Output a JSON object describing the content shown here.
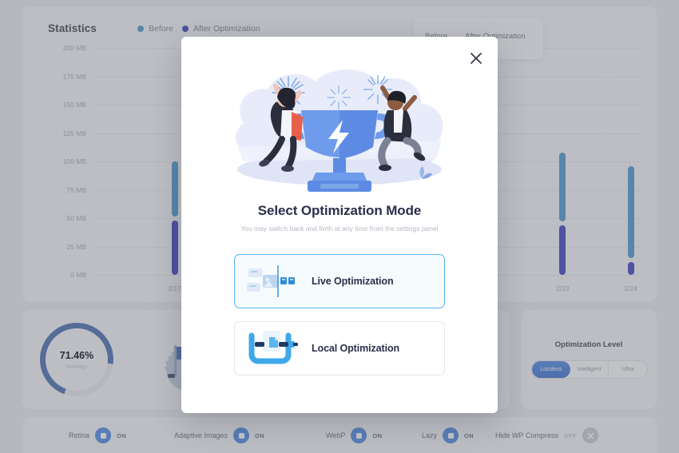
{
  "statistics": {
    "title": "Statistics",
    "legend": [
      {
        "label": "Before",
        "color": "#3d8fc6",
        "icon": "legend-dot-icon"
      },
      {
        "label": "After Optimization",
        "color": "#2e2fb8",
        "icon": "legend-dot-icon"
      }
    ],
    "tooltip": {
      "before_label": "Before",
      "after_label": "After Optimization"
    }
  },
  "chart_data": {
    "type": "bar",
    "title": "Statistics",
    "xlabel": "",
    "ylabel": "",
    "ylim": [
      0,
      200
    ],
    "yunit": "MB",
    "grid": true,
    "legend_position": "top",
    "ytick_labels": [
      "200 MB",
      "175 MB",
      "150 MB",
      "125 MB",
      "100 MB",
      "75 MB",
      "50 MB",
      "25 MB",
      "0 MB"
    ],
    "ytick_values": [
      200,
      175,
      150,
      125,
      100,
      75,
      50,
      25,
      0
    ],
    "categories": [
      "2/17",
      "2/23",
      "2/24"
    ],
    "series": [
      {
        "name": "Before",
        "color": "#3d8fc6",
        "values": [
          100,
          108,
          96
        ]
      },
      {
        "name": "After Optimization",
        "color": "#2e2fb8",
        "values": [
          48,
          44,
          11
        ]
      }
    ]
  },
  "savings": {
    "value": "71.46%",
    "caption": "Savings"
  },
  "optimization_level": {
    "title": "Optimization Level",
    "options": [
      {
        "label": "Lossless",
        "active": true
      },
      {
        "label": "Intelligent",
        "active": false
      },
      {
        "label": "Ultra",
        "active": false
      }
    ]
  },
  "toggles": [
    {
      "label": "Retina",
      "state": "ON",
      "on": true,
      "icon": "retina-icon"
    },
    {
      "label": "Adaptive Images",
      "state": "ON",
      "on": true,
      "icon": "adaptive-images-icon"
    },
    {
      "label": "WebP",
      "state": "ON",
      "on": true,
      "icon": "webp-icon"
    },
    {
      "label": "Lazy",
      "state": "ON",
      "on": true,
      "icon": "lazy-icon"
    },
    {
      "label": "Hide WP Compress",
      "state": "OFF",
      "on": false,
      "icon": "close-icon"
    }
  ],
  "modal": {
    "title": "Select Optimization Mode",
    "subtitle": "You may switch back and forth at any time from the settings panel",
    "close_icon": "close-icon",
    "hero_icon": "trophy-celebration-illustration",
    "options": [
      {
        "label": "Live Optimization",
        "selected": true,
        "icon": "live-optimization-icon"
      },
      {
        "label": "Local Optimization",
        "selected": false,
        "icon": "clamp-icon"
      }
    ]
  },
  "colors": {
    "accent_blue": "#3f7fe0",
    "light_blue": "#3d8fc6",
    "dark_indigo": "#2e2fb8",
    "selected_border": "#56b2ec"
  }
}
